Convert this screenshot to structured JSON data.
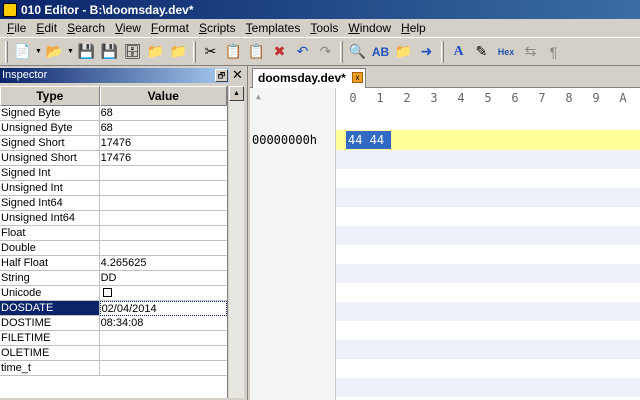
{
  "window": {
    "title": "010 Editor - B:\\doomsday.dev*"
  },
  "menu": [
    {
      "label": "File",
      "key": "F",
      "rest": "ile"
    },
    {
      "label": "Edit",
      "key": "E",
      "rest": "dit"
    },
    {
      "label": "Search",
      "key": "S",
      "rest": "earch"
    },
    {
      "label": "View",
      "key": "V",
      "rest": "iew"
    },
    {
      "label": "Format",
      "key": "F",
      "rest": "ormat"
    },
    {
      "label": "Scripts",
      "key": "S",
      "rest": "cripts"
    },
    {
      "label": "Templates",
      "key": "T",
      "rest": "emplates"
    },
    {
      "label": "Tools",
      "key": "T",
      "rest": "ools"
    },
    {
      "label": "Window",
      "key": "W",
      "rest": "indow"
    },
    {
      "label": "Help",
      "key": "H",
      "rest": "elp"
    }
  ],
  "toolbar": {
    "hex_label": "Hex"
  },
  "inspector": {
    "title": "Inspector",
    "restore_glyph": "🗗",
    "close_glyph": "✕",
    "col_type": "Type",
    "col_value": "Value",
    "rows": [
      {
        "type": "Signed Byte",
        "value": "68"
      },
      {
        "type": "Unsigned Byte",
        "value": "68"
      },
      {
        "type": "Signed Short",
        "value": "17476"
      },
      {
        "type": "Unsigned Short",
        "value": "17476"
      },
      {
        "type": "Signed Int",
        "value": ""
      },
      {
        "type": "Unsigned Int",
        "value": ""
      },
      {
        "type": "Signed Int64",
        "value": ""
      },
      {
        "type": "Unsigned Int64",
        "value": ""
      },
      {
        "type": "Float",
        "value": ""
      },
      {
        "type": "Double",
        "value": ""
      },
      {
        "type": "Half Float",
        "value": "4.265625"
      },
      {
        "type": "String",
        "value": "DD"
      },
      {
        "type": "Unicode",
        "value": "",
        "checkbox": true
      },
      {
        "type": "DOSDATE",
        "value": "02/04/2014",
        "selected": true
      },
      {
        "type": "DOSTIME",
        "value": "08:34:08"
      },
      {
        "type": "FILETIME",
        "value": ""
      },
      {
        "type": "OLETIME",
        "value": ""
      },
      {
        "type": "time_t",
        "value": ""
      }
    ]
  },
  "editor": {
    "tab_label": "doomsday.dev*",
    "tab_close_glyph": "x",
    "columns": [
      "0",
      "1",
      "2",
      "3",
      "4",
      "5",
      "6",
      "7",
      "8",
      "9",
      "A"
    ],
    "address": "00000000h",
    "selected_bytes": "44 44"
  },
  "colors": {
    "title_bar": "#0a246a",
    "selection": "#316ac5",
    "current_row": "#ffff99",
    "row_band": "#eef0fa"
  }
}
